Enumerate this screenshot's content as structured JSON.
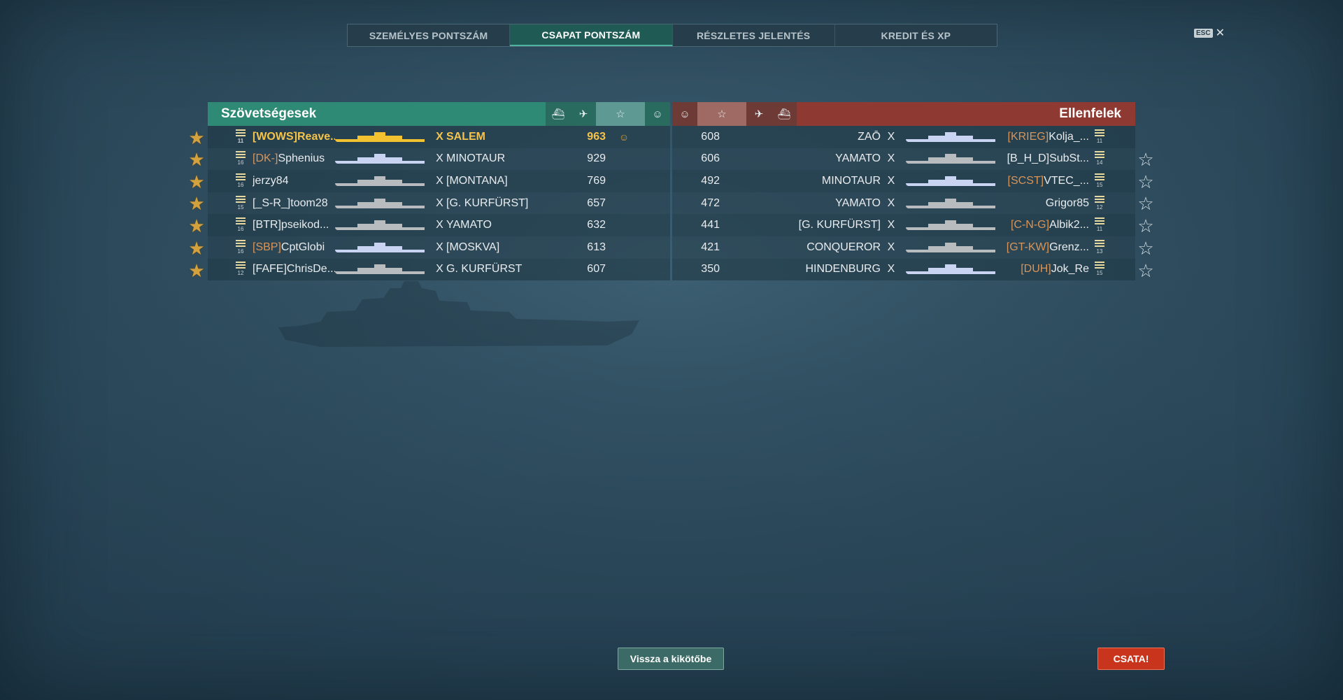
{
  "tabs": [
    {
      "label": "SZEMÉLYES PONTSZÁM",
      "active": false
    },
    {
      "label": "CSAPAT PONTSZÁM",
      "active": true
    },
    {
      "label": "RÉSZLETES JELENTÉS",
      "active": false
    },
    {
      "label": "KREDIT ÉS XP",
      "active": false
    }
  ],
  "esc": {
    "key": "ESC",
    "close": "✕"
  },
  "allies": {
    "title": "Szövetségesek",
    "players": [
      {
        "rank": "11",
        "clan": "[WOWS]",
        "name": "Reave...",
        "cross": "X",
        "ship": "SALEM",
        "score": "963",
        "me": true,
        "status": "☺"
      },
      {
        "rank": "16",
        "clan": "[DK-]",
        "name": "Sphenius",
        "cross": "X",
        "ship": "MINOTAUR",
        "score": "929"
      },
      {
        "rank": "16",
        "clan": "",
        "name": "jerzy84",
        "cross": "X",
        "ship": "[MONTANA]",
        "score": "769"
      },
      {
        "rank": "15",
        "clan": "",
        "name": "[_S-R_]toom28",
        "cross": "X",
        "ship": "[G. KURFÜRST]",
        "score": "657"
      },
      {
        "rank": "16",
        "clan": "",
        "name": "[BTR]pseikod...",
        "cross": "X",
        "ship": "YAMATO",
        "score": "632"
      },
      {
        "rank": "16",
        "clan": "[SBP]",
        "name": "CptGlobi",
        "cross": "X",
        "ship": "[MOSKVA]",
        "score": "613"
      },
      {
        "rank": "12",
        "clan": "",
        "name": "[FAFE]ChrisDe...",
        "cross": "X",
        "ship": "G. KURFÜRST",
        "score": "607"
      }
    ]
  },
  "enemies": {
    "title": "Ellenfelek",
    "players": [
      {
        "score": "608",
        "ship": "ZAŌ",
        "cross": "X",
        "clan": "[KRIEG]",
        "name": "Kolja_...",
        "rank": "11"
      },
      {
        "score": "606",
        "ship": "YAMATO",
        "cross": "X",
        "clan": "",
        "name": "[B_H_D]SubSt...",
        "rank": "14"
      },
      {
        "score": "492",
        "ship": "MINOTAUR",
        "cross": "X",
        "clan": "[SCST]",
        "name": "VTEC_...",
        "rank": "15"
      },
      {
        "score": "472",
        "ship": "YAMATO",
        "cross": "X",
        "clan": "",
        "name": "Grigor85",
        "rank": "12"
      },
      {
        "score": "441",
        "ship": "[G. KURFÜRST]",
        "cross": "X",
        "clan": "[C-N-G]",
        "name": "Albik2...",
        "rank": "11"
      },
      {
        "score": "421",
        "ship": "CONQUEROR",
        "cross": "X",
        "clan": "[GT-KW]",
        "name": "Grenz...",
        "rank": "13"
      },
      {
        "score": "350",
        "ship": "HINDENBURG",
        "cross": "X",
        "clan": "[DUH]",
        "name": "Jok_Re",
        "rank": "15"
      }
    ]
  },
  "buttons": {
    "back_to_port": "Vissza a kikötőbe",
    "battle": "CSATA!"
  },
  "colors": {
    "allies_header": "#2e8a74",
    "enemies_header": "#8e3a33",
    "battle_button": "#c9341c",
    "clan_tag": "#d8955a",
    "own_player": "#f5c34a"
  }
}
